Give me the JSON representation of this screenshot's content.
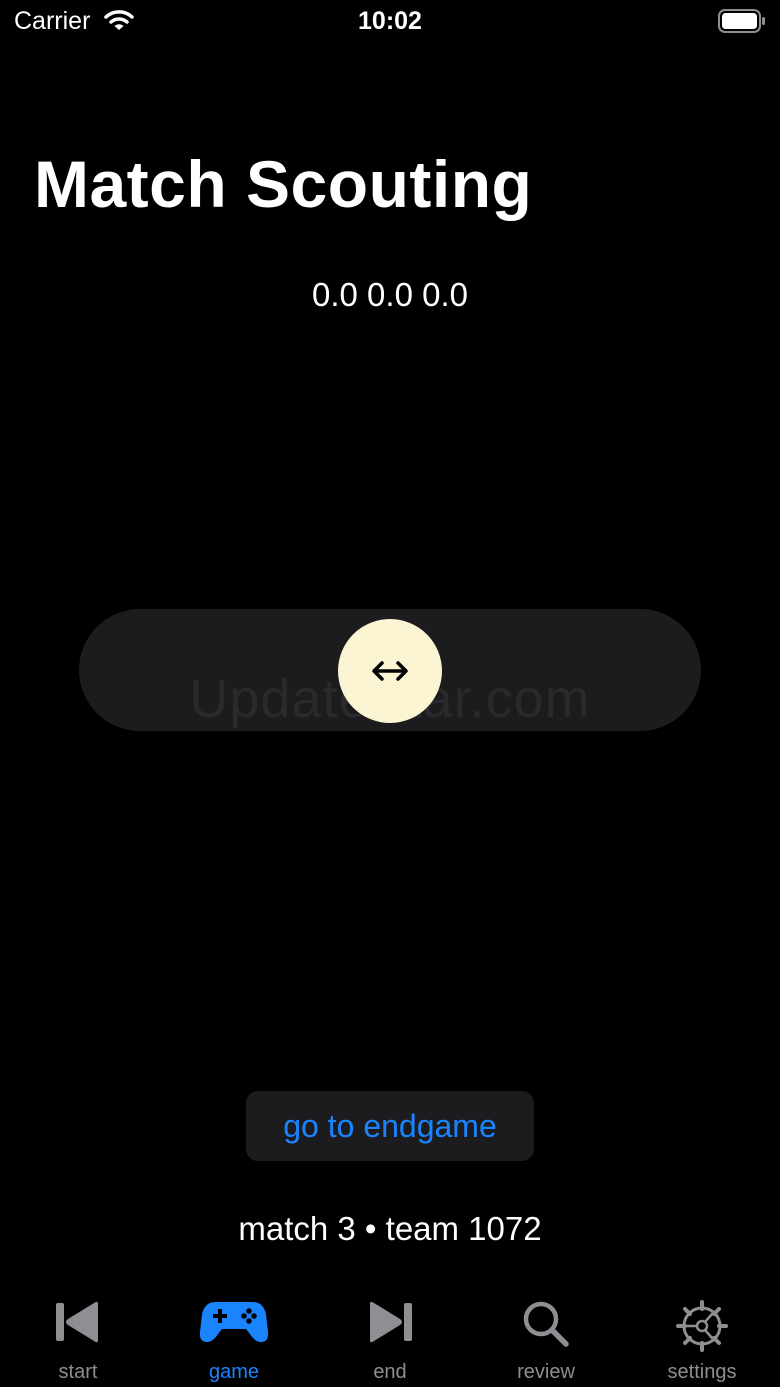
{
  "status_bar": {
    "carrier": "Carrier",
    "time": "10:02"
  },
  "page": {
    "title": "Match Scouting",
    "coords": "0.0 0.0 0.0"
  },
  "slider": {
    "watermark": "UpdateStar.com",
    "knob_color": "#fcf5d3"
  },
  "endgame_button": {
    "label": "go to endgame"
  },
  "match_info": "match 3 • team 1072",
  "tabs": [
    {
      "label": "start",
      "icon": "skip-back-icon"
    },
    {
      "label": "game",
      "icon": "gamecontroller-icon",
      "active": true
    },
    {
      "label": "end",
      "icon": "skip-forward-icon"
    },
    {
      "label": "review",
      "icon": "magnifier-icon"
    },
    {
      "label": "settings",
      "icon": "gear-icon"
    }
  ],
  "colors": {
    "accent": "#1a84ff",
    "inactive_tab": "#8e8e93",
    "control_bg": "#1c1c1e",
    "background": "#000000"
  }
}
